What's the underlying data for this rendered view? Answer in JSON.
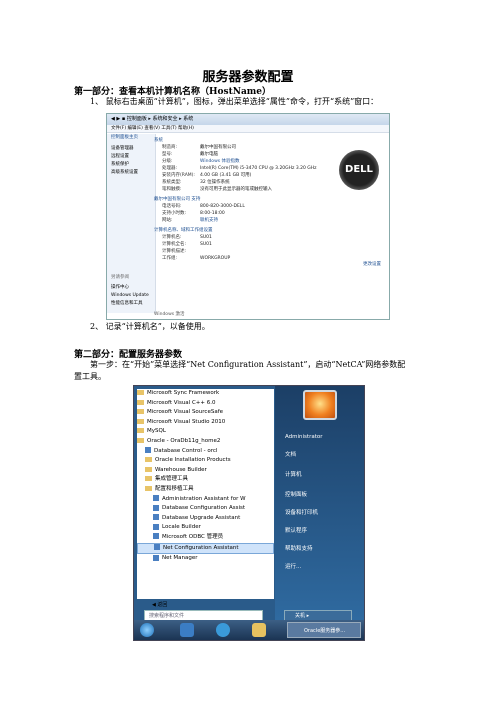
{
  "title": "服务器参数配置",
  "part1": {
    "heading": "第一部分：查看本机计算机名称（HostName）",
    "step1": "1、 鼠标右击桌面“计算机”，图标，弹出菜单选择“属性”命令，打开“系统”窗口：",
    "step2": "2、 记录“计算机名”，以备使用。"
  },
  "part2": {
    "heading": "第二部分：配置服务器参数",
    "step1_line1": "第一步：在“开始”菜单选择“Net Configuration Assistant”，启动“NetCA”网络参数配",
    "step1_line2": "置工具。"
  },
  "shot1": {
    "breadcrumb": "◀ ▶ ▪ 控制面板 ▸ 系统和安全 ▸ 系统",
    "menu": "文件(F)  编辑(E)  查看(V)  工具(T)  帮助(H)",
    "side": [
      "控制面板主页",
      "设备管理器",
      "远程设置",
      "系统保护",
      "高级系统设置"
    ],
    "side_bottom": [
      "另请参阅",
      "操作中心",
      "Windows Update",
      "性能信息和工具"
    ],
    "sec_system": "系统",
    "rows": [
      [
        "制造商:",
        "戴尔中国有限公司"
      ],
      [
        "型号:",
        "戴尔电脑"
      ],
      [
        "分级:",
        "Windows 体验指数"
      ],
      [
        "处理器:",
        "Intel(R) Core(TM) i5-3470 CPU @ 3.20GHz 3.20 GHz"
      ],
      [
        "安装内存(RAM):",
        "4.00 GB (3.41 GB 可用)"
      ],
      [
        "系统类型:",
        "32 位操作系统"
      ],
      [
        "笔和触摸:",
        "没有可用于此显示器的笔或触控输入"
      ]
    ],
    "sec_support": "戴尔中国有限公司 支持",
    "support": [
      [
        "电话号码:",
        "800-820-3000-DELL"
      ],
      [
        "支持小时数:",
        "8:00-18:00"
      ],
      [
        "网站:",
        "联机支持"
      ]
    ],
    "sec_name": "计算机名称、域和工作组设置",
    "name_rows": [
      [
        "计算机名:",
        "SU01"
      ],
      [
        "计算机全名:",
        "SU01"
      ],
      [
        "计算机描述:",
        ""
      ],
      [
        "工作组:",
        "WORKGROUP"
      ]
    ],
    "change": "更改设置",
    "footer": "Windows 激活",
    "logo": "DELL"
  },
  "shot2": {
    "items": [
      "Microsoft Sync Framework",
      "Microsoft Visual C++ 6.0",
      "Microsoft Visual SourceSafe",
      "Microsoft Visual Studio 2010",
      "MySQL",
      "Oracle - OraDb11g_home2",
      "Database Control - orcl",
      "Oracle Installation Products",
      "Warehouse Builder",
      "集成管理工具",
      "配置和移植工具",
      "Administration Assistant for W",
      "Database Configuration Assist",
      "Database Upgrade Assistant",
      "Locale Builder",
      "Microsoft ODBC 管理员",
      "Net Configuration Assistant",
      "Net Manager"
    ],
    "back": "◀ 返回",
    "search": "搜索程序和文件",
    "right": [
      "Administrator",
      "文档",
      "计算机",
      "控制面板",
      "设备和打印机",
      "默认程序",
      "帮助和支持",
      "运行..."
    ],
    "shutdown": "关机 ▸",
    "taskbtn": "Oracle服务器参..."
  }
}
